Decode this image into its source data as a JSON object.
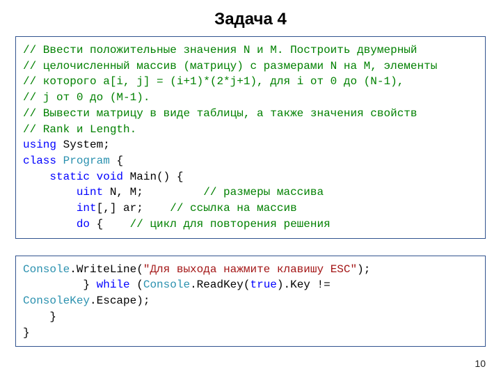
{
  "title": "Задача 4",
  "code1": {
    "l1": "// Ввести положительные значения N и M. Построить двумерный",
    "l2": "// целочисленный массив (матрицу) с размерами N на M, элементы",
    "l3": "// которого a[i, j] = (i+1)*(2*j+1), для i от 0 до (N-1),",
    "l4": "// j от 0 до (M-1).",
    "l5": "// Вывести матрицу в виде таблицы, а также значения свойств",
    "l6": "// Rank и Length.",
    "using": "using",
    "system": " System;",
    "class": "class",
    "program": "Program",
    "brace_open": " {",
    "static": "static",
    "void": "void",
    "main": " Main() {",
    "uint": "uint",
    "nm": " N, M;         ",
    "c_nm": "// размеры массива",
    "int": "int",
    "arr": "[,] ar;    ",
    "c_arr": "// ссылка на массив",
    "do": "do",
    "do_rest": " {    ",
    "c_do": "// цикл для повторения решения"
  },
  "code2": {
    "console": "Console",
    "writeline": ".WriteLine(",
    "str": "\"Для выхода нажмите клавишу ESC\"",
    "wl_end": ");",
    "close_brace": "         } ",
    "while": "while",
    "console2": "Console",
    "readkey": ".ReadKey(",
    "true": "true",
    "rk_end": ").Key != ",
    "consolekey": "ConsoleKey",
    "escape": ".Escape);",
    "brace1": "    }",
    "brace2": "}"
  },
  "pagenum": "10"
}
